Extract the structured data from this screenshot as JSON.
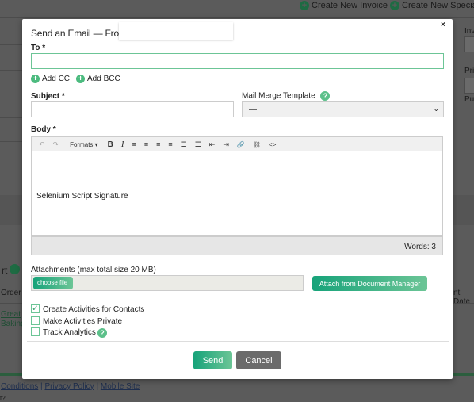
{
  "background": {
    "actions": [
      "Create New Invoice",
      "Create New Special"
    ],
    "right_labels": [
      "Inv",
      "Pri",
      "Pu"
    ],
    "left_fragments": [
      "rt",
      "Order",
      "Great",
      "Baking",
      "nt Date"
    ],
    "footer_links": [
      "Conditions",
      "Privacy Policy",
      "Mobile Site"
    ],
    "footer_sep": "|",
    "footer_bottom": "t?"
  },
  "modal": {
    "title": "Send an Email — From",
    "close": "×",
    "to_label": "To *",
    "to_value": "",
    "add_cc": "Add CC",
    "add_bcc": "Add BCC",
    "subject_label": "Subject *",
    "subject_value": "",
    "template_label": "Mail Merge Template",
    "template_value": "—",
    "body_label": "Body *",
    "toolbar": {
      "undo": "↶",
      "redo": "↷",
      "formats": "Formats ▾",
      "bold": "B",
      "italic": "I",
      "align_left": "≡",
      "align_center": "≡",
      "align_right": "≡",
      "justify": "≡",
      "bullets": "☰",
      "numbered": "☰",
      "outdent": "⇤",
      "indent": "⇥",
      "link": "🔗",
      "unlink": "⛓",
      "code": "<>"
    },
    "body_text": "Selenium Script Signature",
    "word_count": "Words: 3",
    "attachments_label": "Attachments (max total size 20 MB)",
    "choose_file": "choose file",
    "attach_dm": "Attach from Document Manager",
    "checkboxes": [
      {
        "label": "Create Activities for Contacts",
        "checked": true
      },
      {
        "label": "Make Activities Private",
        "checked": false
      },
      {
        "label": "Track Analytics",
        "checked": false
      }
    ],
    "send": "Send",
    "cancel": "Cancel"
  },
  "colors": {
    "accent": "#17a37a",
    "overlay": "#5b5b5b",
    "cancel": "#6b6b6b"
  }
}
